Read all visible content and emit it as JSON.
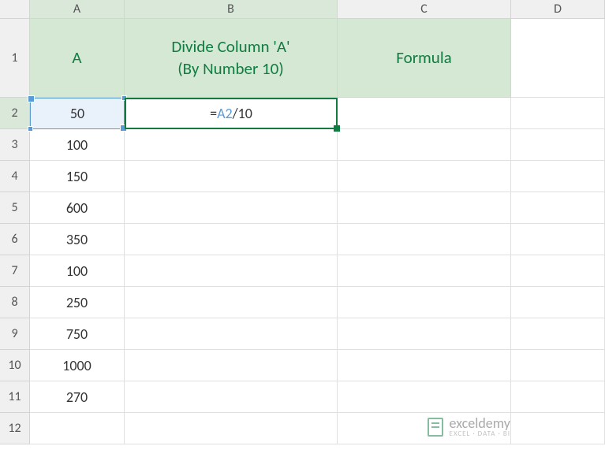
{
  "columns": {
    "A": "A",
    "B": "B",
    "C": "C",
    "D": "D"
  },
  "rows": [
    "1",
    "2",
    "3",
    "4",
    "5",
    "6",
    "7",
    "8",
    "9",
    "10",
    "11",
    "12"
  ],
  "headers": {
    "A": "A",
    "B_line1": "Divide Column 'A'",
    "B_line2": "(By Number 10)",
    "C": "Formula"
  },
  "dataA": [
    "50",
    "100",
    "150",
    "600",
    "350",
    "100",
    "250",
    "750",
    "1000",
    "270"
  ],
  "formula": {
    "prefix": "=",
    "ref": "A2",
    "suffix": "/10"
  },
  "watermark": {
    "name": "exceldemy",
    "tag": "EXCEL · DATA · BI"
  },
  "chart_data": {
    "type": "table",
    "title": "Divide Column 'A' (By Number 10)",
    "columns": [
      "A",
      "Divide Column 'A' (By Number 10)",
      "Formula"
    ],
    "values_A": [
      50,
      100,
      150,
      600,
      350,
      100,
      250,
      750,
      1000,
      270
    ],
    "formula_B2": "=A2/10"
  }
}
